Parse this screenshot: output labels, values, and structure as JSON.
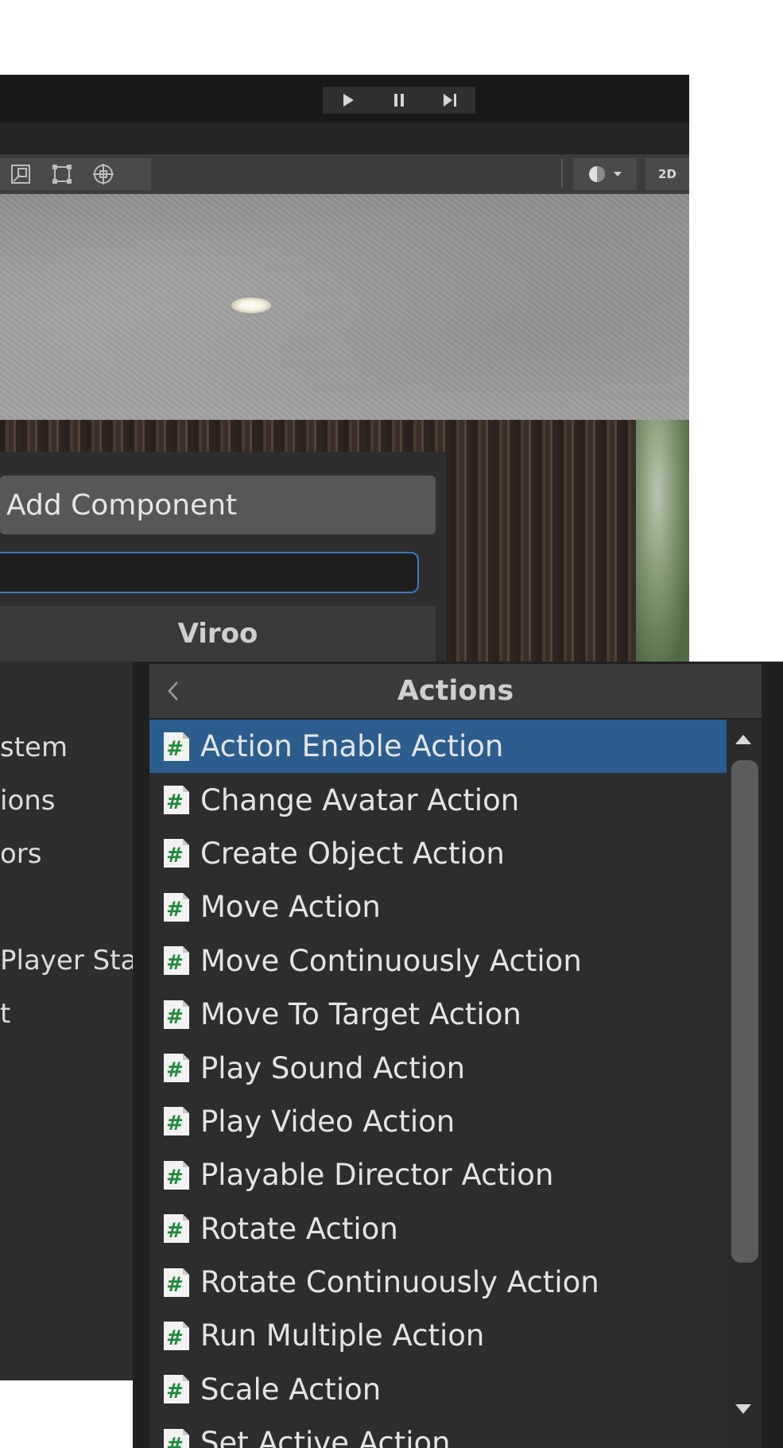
{
  "playbar": {
    "play_icon": "play-icon",
    "pause_icon": "pause-icon",
    "step_icon": "step-icon"
  },
  "scene_toolbar": {
    "tools": [
      "scale-tool-icon",
      "rect-tool-icon",
      "transform-tool-icon"
    ],
    "shading_icon": "shading-sphere-icon",
    "mode_2d_label": "2D"
  },
  "add_component": {
    "button_label": "Add Component",
    "search_value": "",
    "category_title": "Viroo",
    "left_items": [
      "stem",
      "ions",
      "ors",
      "",
      "Player Sta",
      "t"
    ]
  },
  "actions_dropdown": {
    "back_icon": "chevron-left-icon",
    "title": "Actions",
    "items": [
      {
        "label": "Action Enable Action",
        "selected": true
      },
      {
        "label": "Change Avatar Action",
        "selected": false
      },
      {
        "label": "Create Object Action",
        "selected": false
      },
      {
        "label": "Move Action",
        "selected": false
      },
      {
        "label": "Move Continuously Action",
        "selected": false
      },
      {
        "label": "Move To Target Action",
        "selected": false
      },
      {
        "label": "Play Sound Action",
        "selected": false
      },
      {
        "label": "Play Video Action",
        "selected": false
      },
      {
        "label": "Playable Director Action",
        "selected": false
      },
      {
        "label": "Rotate Action",
        "selected": false
      },
      {
        "label": "Rotate Continuously Action",
        "selected": false
      },
      {
        "label": "Run Multiple Action",
        "selected": false
      },
      {
        "label": "Scale Action",
        "selected": false
      },
      {
        "label": "Set Active Action",
        "selected": false
      }
    ]
  },
  "colors": {
    "selection": "#2c5d8f",
    "script_icon_green": "#1f8a3a",
    "focus_border": "#3b7bc2"
  }
}
